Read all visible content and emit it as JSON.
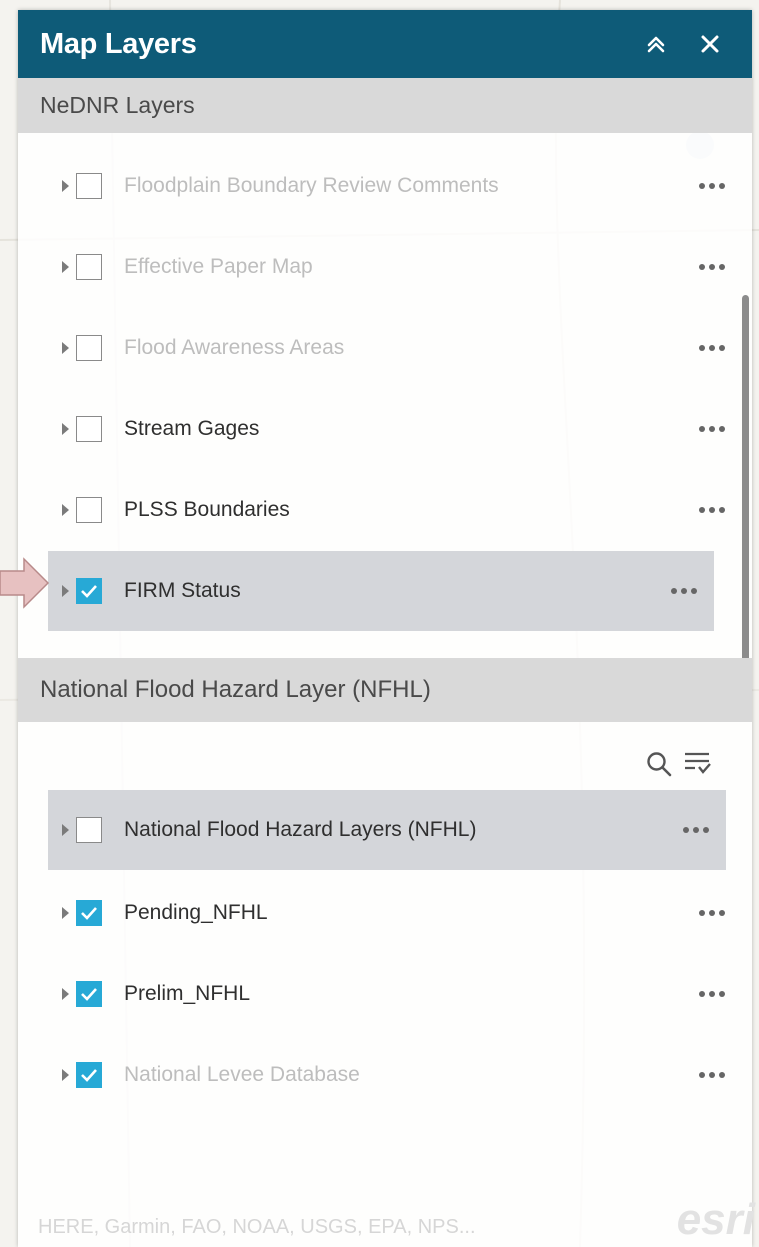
{
  "header": {
    "title": "Map Layers"
  },
  "sections": [
    {
      "label": "NeDNR Layers"
    },
    {
      "label": "National Flood Hazard Layer (NFHL)"
    }
  ],
  "layers": [
    {
      "label": "Floodplain Boundary Review Comments",
      "checked": false,
      "dimmed": true
    },
    {
      "label": "Effective Paper Map",
      "checked": false,
      "dimmed": true
    },
    {
      "label": "Flood Awareness Areas",
      "checked": false,
      "dimmed": true
    },
    {
      "label": "Stream Gages",
      "checked": false,
      "dimmed": false
    },
    {
      "label": "PLSS Boundaries",
      "checked": false,
      "dimmed": false
    },
    {
      "label": "FIRM Status",
      "checked": true,
      "dimmed": false,
      "selected": true
    },
    {
      "label": "National Flood Hazard Layers (NFHL)",
      "checked": false,
      "dimmed": false,
      "selected": true
    },
    {
      "label": "Pending_NFHL",
      "checked": true,
      "dimmed": false
    },
    {
      "label": "Prelim_NFHL",
      "checked": true,
      "dimmed": false
    },
    {
      "label": "National Levee Database",
      "checked": true,
      "dimmed": true
    }
  ],
  "attribution": {
    "text": "HERE, Garmin, FAO, NOAA, USGS, EPA, NPS...",
    "logo": "esri"
  },
  "colors": {
    "header": "#0e5b78",
    "checkbox": "#27a9d6",
    "section": "#d9d9d9",
    "arrow": "#e7c1c1"
  },
  "icons": [
    "collapse-icon",
    "close-icon",
    "search-icon",
    "filter-icon",
    "expand-caret-icon",
    "more-icon",
    "checkmark-icon",
    "pointer-arrow-icon"
  ]
}
